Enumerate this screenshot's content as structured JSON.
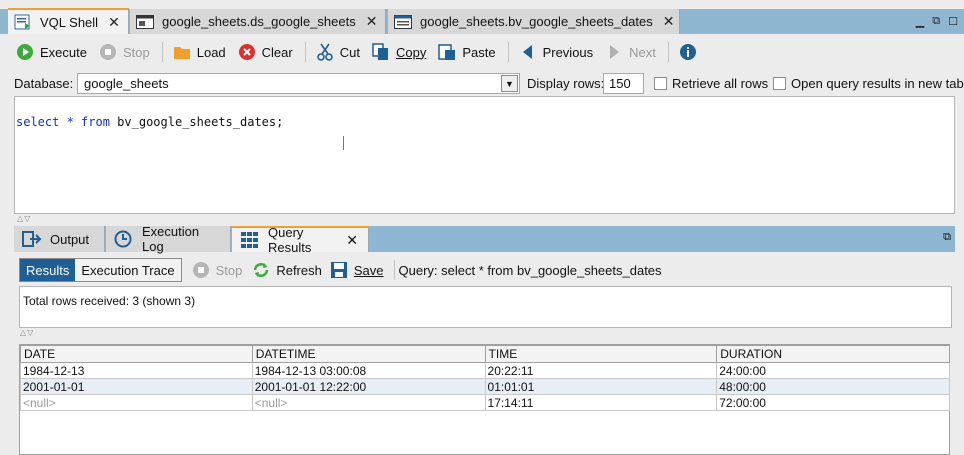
{
  "editor_tabs": [
    {
      "label": "VQL Shell",
      "icon": "vql-shell-icon",
      "active": true
    },
    {
      "label": "google_sheets.ds_google_sheets",
      "icon": "datasource-icon",
      "active": false
    },
    {
      "label": "google_sheets.bv_google_sheets_dates",
      "icon": "base-view-icon",
      "active": false
    }
  ],
  "toolbar": {
    "execute": "Execute",
    "stop": "Stop",
    "load": "Load",
    "clear": "Clear",
    "cut": "Cut",
    "copy": "Copy",
    "paste": "Paste",
    "previous": "Previous",
    "next": "Next"
  },
  "database": {
    "label": "Database:",
    "value": "google_sheets",
    "display_rows_label": "Display rows:",
    "display_rows_value": "150",
    "retrieve_all_label": "Retrieve all rows",
    "open_new_tab_label": "Open query results in new tab"
  },
  "query": {
    "kw_select": "select",
    "star": " * ",
    "kw_from": "from",
    "rest": " bv_google_sheets_dates;"
  },
  "panel_tabs": [
    {
      "label": "Output",
      "icon": "output-icon"
    },
    {
      "label": "Execution Log",
      "icon": "execution-log-icon"
    },
    {
      "label": "Query Results",
      "icon": "query-results-icon",
      "active": true
    }
  ],
  "results_toolbar": {
    "results": "Results",
    "execution_trace": "Execution Trace",
    "stop": "Stop",
    "refresh": "Refresh",
    "save": "Save",
    "query_text": "Query: select * from bv_google_sheets_dates"
  },
  "total_rows": "Total rows received: 3 (shown 3)",
  "table": {
    "columns": [
      "DATE",
      "DATETIME",
      "TIME",
      "DURATION"
    ],
    "rows": [
      [
        "1984-12-13",
        "1984-12-13 03:00:08",
        "20:22:11",
        "24:00:00"
      ],
      [
        "2001-01-01",
        "2001-01-01 12:22:00",
        "01:01:01",
        "48:00:00"
      ],
      [
        "<null>",
        "<null>",
        "17:14:11",
        "72:00:00"
      ]
    ]
  }
}
